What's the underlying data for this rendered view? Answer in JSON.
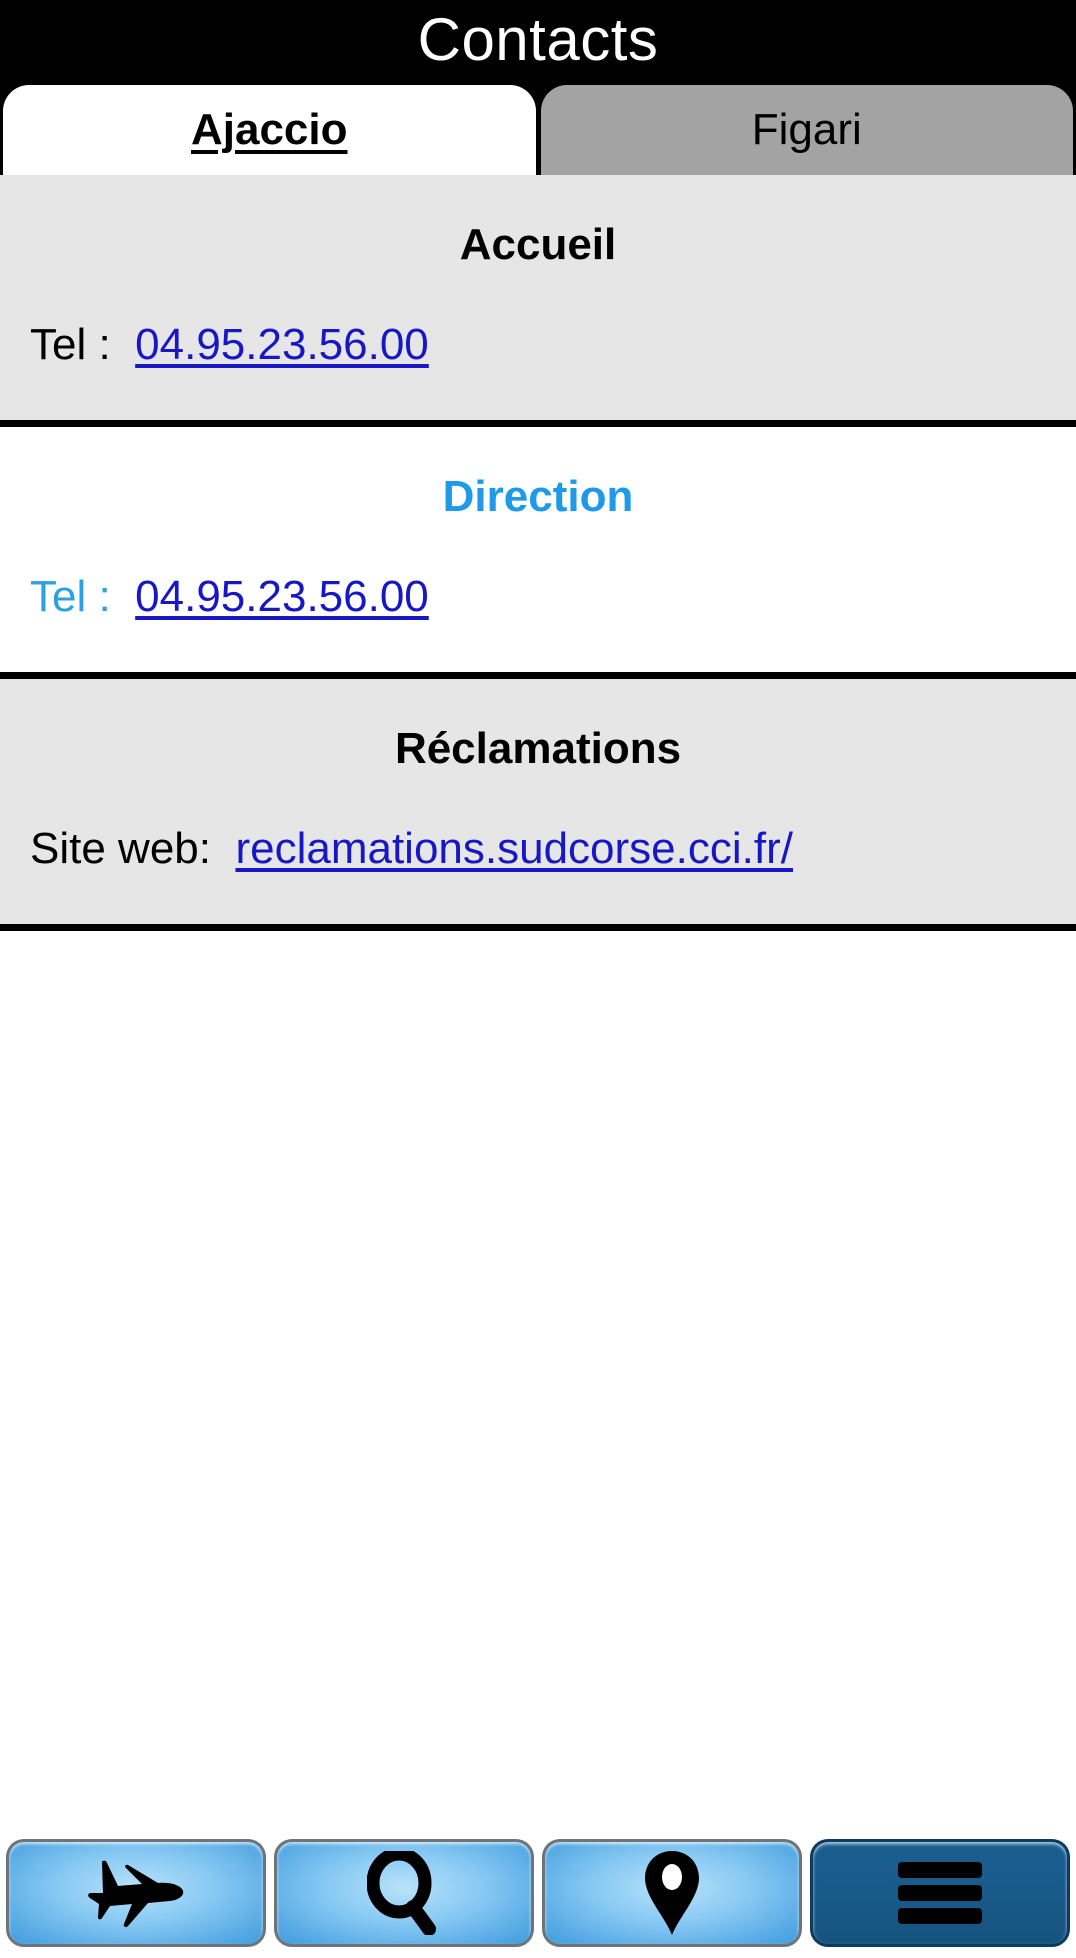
{
  "header": {
    "title": "Contacts"
  },
  "tabs": [
    {
      "label": "Ajaccio",
      "active": true
    },
    {
      "label": "Figari",
      "active": false
    }
  ],
  "sections": [
    {
      "title": "Accueil",
      "style": "gray",
      "rows": [
        {
          "label": "Tel :",
          "link": "04.95.23.56.00"
        }
      ]
    },
    {
      "title": "Direction",
      "style": "white",
      "rows": [
        {
          "label": "Tel :",
          "link": "04.95.23.56.00"
        }
      ]
    },
    {
      "title": "Réclamations",
      "style": "gray",
      "rows": [
        {
          "label": "Site web:",
          "link": "reclamations.sudcorse.cci.fr/"
        }
      ]
    }
  ],
  "bottom_nav": [
    {
      "icon": "airplane-icon",
      "active": false
    },
    {
      "icon": "search-icon",
      "active": false
    },
    {
      "icon": "map-pin-icon",
      "active": false
    },
    {
      "icon": "hamburger-menu-icon",
      "active": true
    }
  ],
  "colors": {
    "header_bg": "#000000",
    "tab_active_bg": "#ffffff",
    "tab_inactive_bg": "#a3a3a3",
    "section_gray_bg": "#e6e6e6",
    "section_white_bg": "#ffffff",
    "link": "#1717c4",
    "accent_blue": "#1e9ae8",
    "label_blue": "#2aa1e2",
    "divider": "#000000"
  }
}
